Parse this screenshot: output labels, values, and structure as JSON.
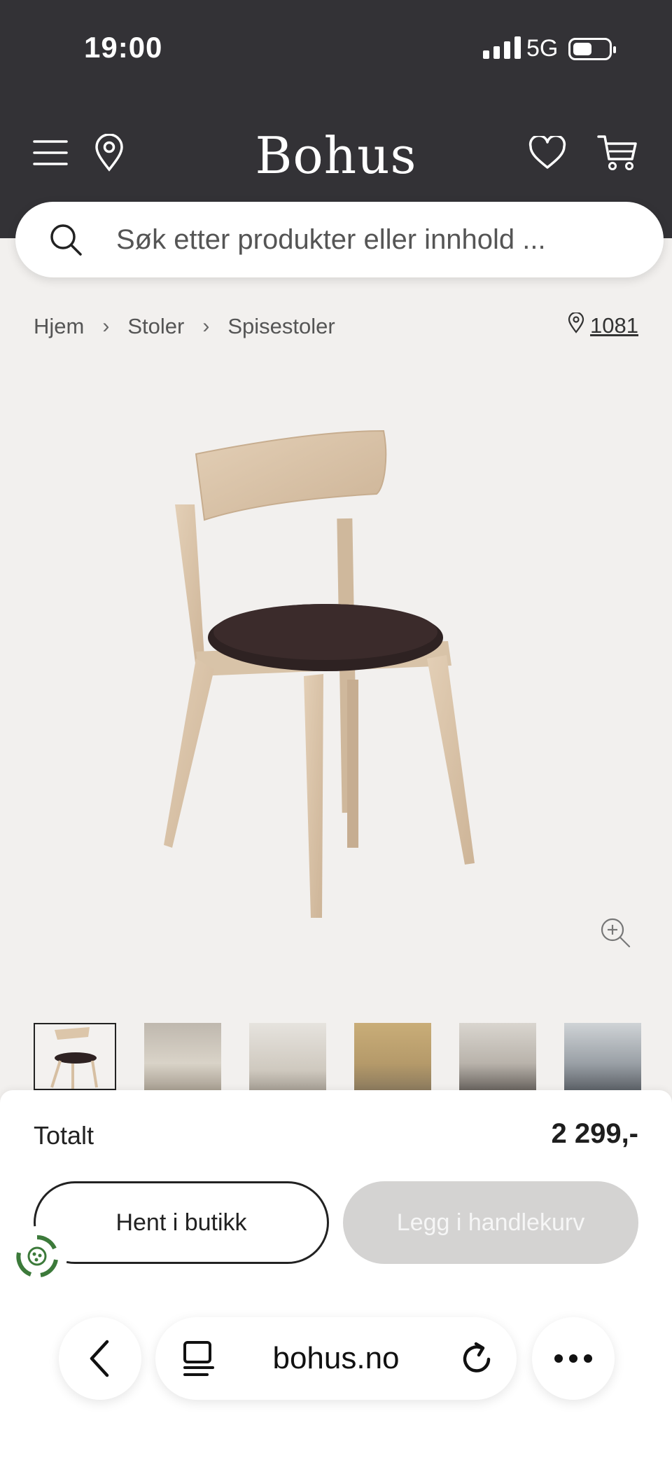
{
  "status_bar": {
    "time": "19:00",
    "network": "5G"
  },
  "header": {
    "brand": "Bohus"
  },
  "search": {
    "placeholder": "Søk etter produkter eller innhold ..."
  },
  "breadcrumb": {
    "items": [
      "Hjem",
      "Stoler",
      "Spisestoler"
    ]
  },
  "store": {
    "value": "1081"
  },
  "bottom": {
    "total_label": "Totalt",
    "total_value": "2 299,-",
    "pickup_label": "Hent i butikk",
    "cart_label": "Legg i handlekurv"
  },
  "browser": {
    "url": "bohus.no"
  }
}
